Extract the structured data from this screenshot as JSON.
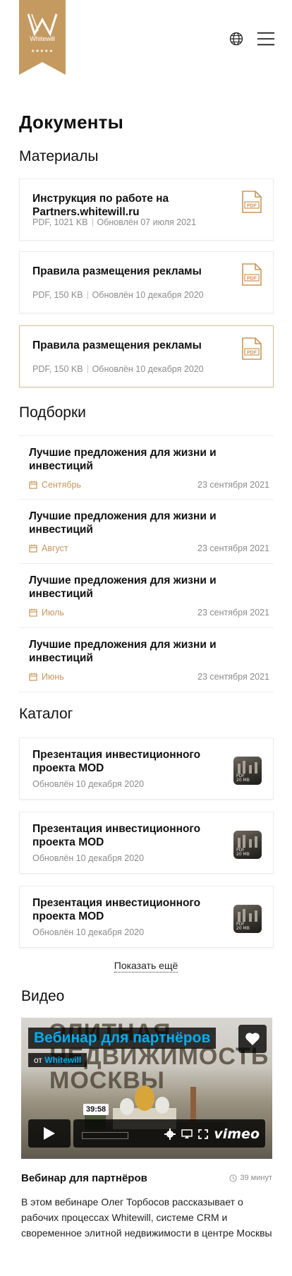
{
  "header": {
    "logo_text": "Whitewill",
    "logo_stars": "★★★★★",
    "globe_icon": "globe-icon",
    "menu_icon": "hamburger-menu-icon"
  },
  "page_title": "Документы",
  "materials": {
    "title": "Материалы",
    "items": [
      {
        "title": "Инструкция по работе на Partners.whitewill.ru",
        "format": "PDF, 1021 KB",
        "updated": "Обновлён  07 июля 2021"
      },
      {
        "title": "Правила размещения рекламы",
        "format": "PDF, 150 KB",
        "updated": "Обновлён  10 декабря 2020"
      },
      {
        "title": "Правила размещения рекламы",
        "format": "PDF, 150 KB",
        "updated": "Обновлён  10 декабря 2020"
      }
    ],
    "pdf_label": "PDF"
  },
  "selections": {
    "title": "Подборки",
    "items": [
      {
        "title": "Лучшие предложения для жизни и инвестиций",
        "month": "Сентябрь",
        "date": "23 сентября 2021"
      },
      {
        "title": "Лучшие предложения для жизни и инвестиций",
        "month": "Август",
        "date": "23 сентября 2021"
      },
      {
        "title": "Лучшие предложения для жизни и инвестиций",
        "month": "Июль",
        "date": "23 сентября 2021"
      },
      {
        "title": "Лучшие предложения для жизни и инвестиций",
        "month": "Июнь",
        "date": "23 сентября 2021"
      }
    ]
  },
  "catalog": {
    "title": "Каталог",
    "items": [
      {
        "title": "Презентация инвестиционного проекта MOD",
        "updated": "Обновлён  10 декабря 2020",
        "thumb_format": "PDF",
        "thumb_size": "20 MB"
      },
      {
        "title": "Презентация инвестиционного проекта MOD",
        "updated": "Обновлён  10 декабря 2020",
        "thumb_format": "PDF",
        "thumb_size": "20 MB"
      },
      {
        "title": "Презентация инвестиционного проекта MOD",
        "updated": "Обновлён  10 декабря 2020",
        "thumb_format": "PDF",
        "thumb_size": "20 MB"
      }
    ],
    "show_more": "Показать ещё"
  },
  "video": {
    "title": "Видео",
    "player": {
      "overlay_title": "Вебинар для партнёров",
      "by_prefix": "от",
      "by_author": "Whitewill",
      "bg_text_line1": "ЭЛИТНАЯ",
      "bg_text_line2": "НЕДВИЖИМОСТЬ",
      "bg_text_line3": "МОСКВЫ",
      "time": "39:58",
      "brand": "vimeo"
    },
    "name": "Вебинар для партнёров",
    "duration": "39 минут",
    "description": "В этом вебинаре Олег Торбосов рассказывает о рабочих процессах Whitewill, системе CRM и своременное  элитной недвижимости в центре Москвы"
  },
  "colors": {
    "accent_gold": "#c9955a",
    "logo_gold": "#c59a61",
    "vimeo_blue": "#00adef"
  }
}
